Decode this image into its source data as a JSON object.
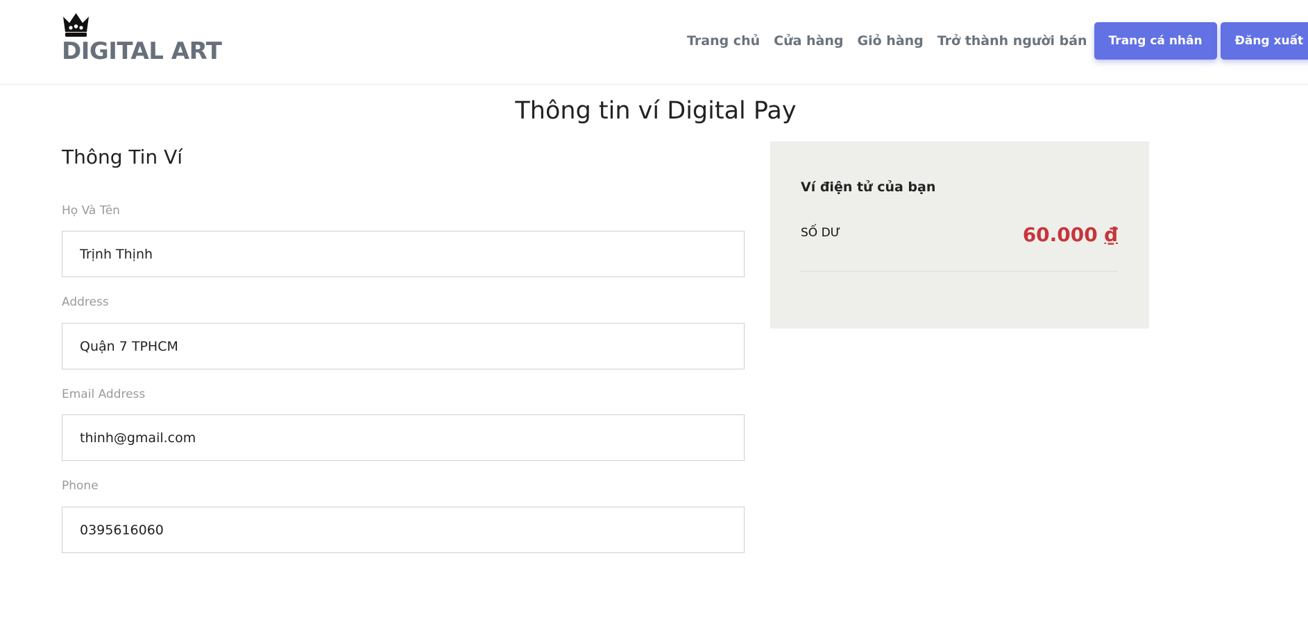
{
  "brand": {
    "name": "DIGITAL ART",
    "logo_icon": "crown-icon"
  },
  "nav": {
    "home": "Trang chủ",
    "shop": "Cửa hàng",
    "cart": "Giỏ hàng",
    "become_seller": "Trở thành người bán",
    "profile_button": "Trang cá nhân",
    "logout_button": "Đăng xuất"
  },
  "page": {
    "title": "Thông tin ví Digital Pay"
  },
  "wallet_form": {
    "section_title": "Thông Tin Ví",
    "fields": [
      {
        "label": "Họ Và Tên",
        "value": "Trịnh Thịnh"
      },
      {
        "label": "Address",
        "value": "Quận 7 TPHCM"
      },
      {
        "label": "Email Address",
        "value": "thinh@gmail.com"
      },
      {
        "label": "Phone",
        "value": "0395616060"
      }
    ]
  },
  "wallet_card": {
    "title": "Ví điện tử của bạn",
    "balance_label": "SỐ DƯ",
    "balance_amount": "60.000",
    "currency_symbol": "₫"
  },
  "colors": {
    "accent": "#6271e3",
    "balance": "#c7353a",
    "brand_text": "#67707a",
    "card_background": "#eeefeb"
  }
}
